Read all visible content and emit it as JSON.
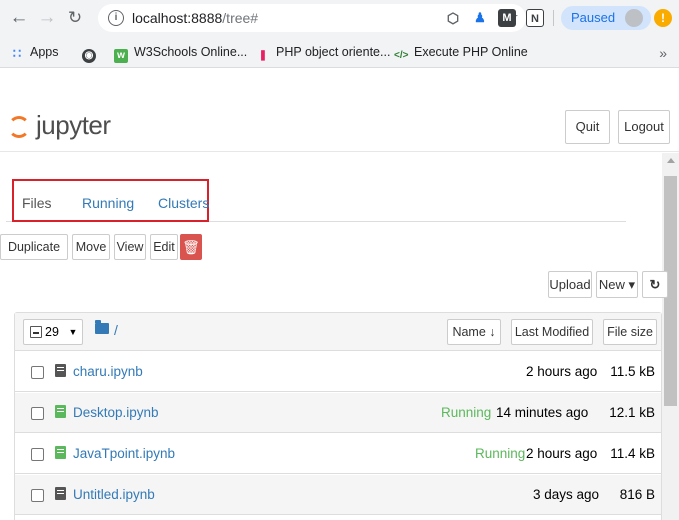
{
  "browser": {
    "url_host": "localhost:8888",
    "url_path": "/tree#",
    "paused_label": "Paused",
    "bookmarks": [
      {
        "label": "Apps"
      },
      {
        "label": ""
      },
      {
        "label": "W3Schools Online..."
      },
      {
        "label": "PHP object oriente..."
      },
      {
        "label": "Execute PHP Online"
      }
    ],
    "bookmarks_more": "»"
  },
  "header": {
    "logo_text": "jupyter",
    "quit_label": "Quit",
    "logout_label": "Logout"
  },
  "tabs": [
    {
      "label": "Files",
      "active": true
    },
    {
      "label": "Running",
      "active": false
    },
    {
      "label": "Clusters",
      "active": false
    }
  ],
  "toolbar": {
    "duplicate_label": "Duplicate",
    "move_label": "Move",
    "view_label": "View",
    "edit_label": "Edit",
    "upload_label": "Upload",
    "new_label": "New ▾"
  },
  "list": {
    "selected_count": "29",
    "breadcrumb": "/",
    "columns": {
      "name": "Name ↓",
      "last_modified": "Last Modified",
      "file_size": "File size"
    },
    "rows": [
      {
        "name": "charu.ipynb",
        "status": "",
        "modified": "2 hours ago",
        "size": "11.5 kB"
      },
      {
        "name": "Desktop.ipynb",
        "status": "Running",
        "modified": "14 minutes ago",
        "size": "12.1 kB"
      },
      {
        "name": "JavaTpoint.ipynb",
        "status": "Running",
        "modified": "2 hours ago",
        "size": "11.4 kB"
      },
      {
        "name": "Untitled.ipynb",
        "status": "",
        "modified": "3 days ago",
        "size": "816 B"
      }
    ]
  },
  "colors": {
    "link": "#337ab7",
    "running": "#5cb85c",
    "highlight_border": "#d9212b",
    "delete_button": "#d9534f",
    "logo_orange": "#f37726"
  }
}
